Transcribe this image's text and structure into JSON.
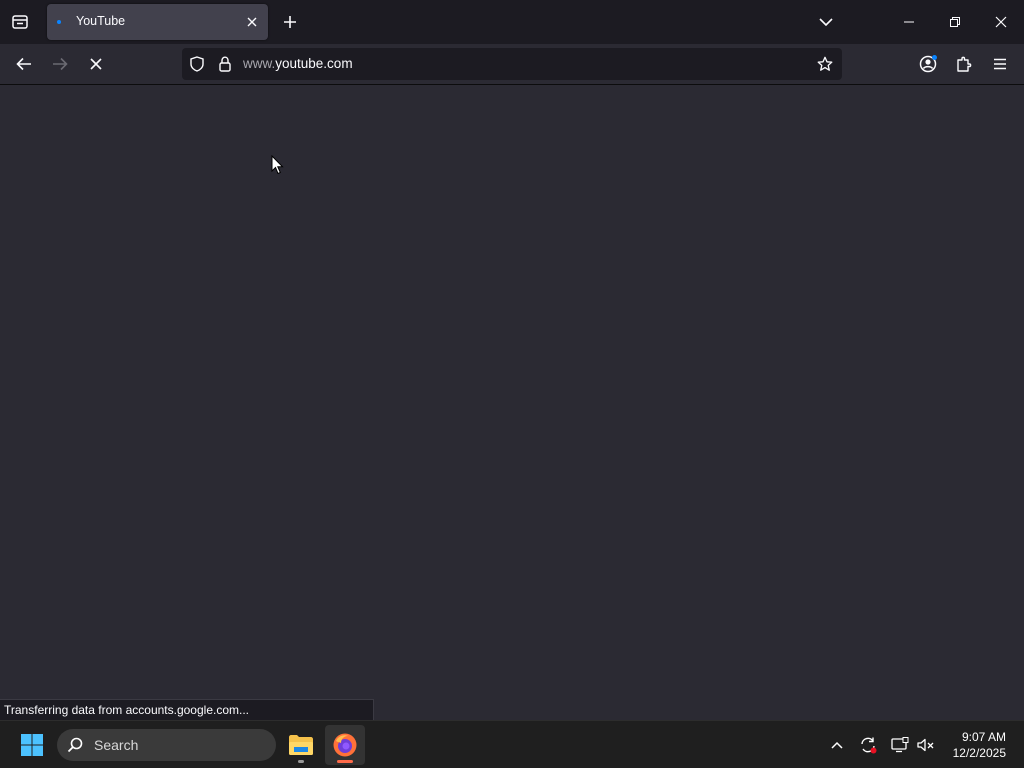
{
  "browser": {
    "tab": {
      "title": "YouTube"
    },
    "url": {
      "prefix": "www.",
      "domain": "youtube.com"
    },
    "status": "Transferring data from accounts.google.com..."
  },
  "taskbar": {
    "search_placeholder": "Search",
    "clock": {
      "time": "9:07 AM",
      "date": "12/2/2025"
    }
  },
  "colors": {
    "accent": "#0a84ff",
    "page_background": "#2b2a33",
    "toolbar_background": "#1c1b22"
  }
}
